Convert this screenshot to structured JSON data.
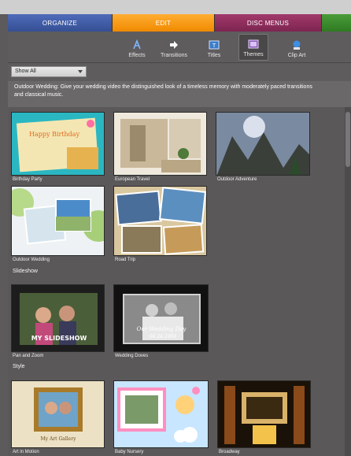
{
  "tabs": [
    {
      "label": "ORGANIZE",
      "color": "#3f5aa6"
    },
    {
      "label": "EDIT",
      "color": "#f59a1a"
    },
    {
      "label": "DISC MENUS",
      "color": "#8e2e5c"
    },
    {
      "label": "",
      "color": "#3b8a2e"
    }
  ],
  "toolbar": {
    "items": [
      {
        "label": "Effects",
        "icon": "effects-icon"
      },
      {
        "label": "Transitions",
        "icon": "transitions-icon"
      },
      {
        "label": "Titles",
        "icon": "titles-icon"
      },
      {
        "label": "Themes",
        "icon": "themes-icon",
        "active": true
      },
      {
        "label": "Clip Art",
        "icon": "clip-art-icon"
      }
    ]
  },
  "filter": {
    "selected": "Show All"
  },
  "description": {
    "line1": "Outdoor Wedding: Give your wedding video the distinguished look of a timeless memory with moderately paced transitions",
    "line2": "and classical music."
  },
  "sections": {
    "slideshow": "Slideshow",
    "style": "Style"
  },
  "themes": {
    "birthday_party": "Birthday Party",
    "european_travel": "European Travel",
    "outdoor_adventure": "Outdoor Adventure",
    "outdoor_wedding": "Outdoor Wedding",
    "road_trip": "Road Trip",
    "pan_and_zoom": "Pan and Zoom",
    "wedding_doves": "Wedding Doves",
    "art_in_motion": "Art in Motion",
    "baby_nursery": "Baby Nursery",
    "broadway": "Broadway"
  },
  "thumb_text": {
    "happy_birthday": "Happy Birthday",
    "my_slideshow": "MY SLIDESHOW",
    "our_wedding_day": "Our Wedding Day",
    "wedding_date": "04.24.2004",
    "my_art_gallery": "My Art Gallery"
  }
}
